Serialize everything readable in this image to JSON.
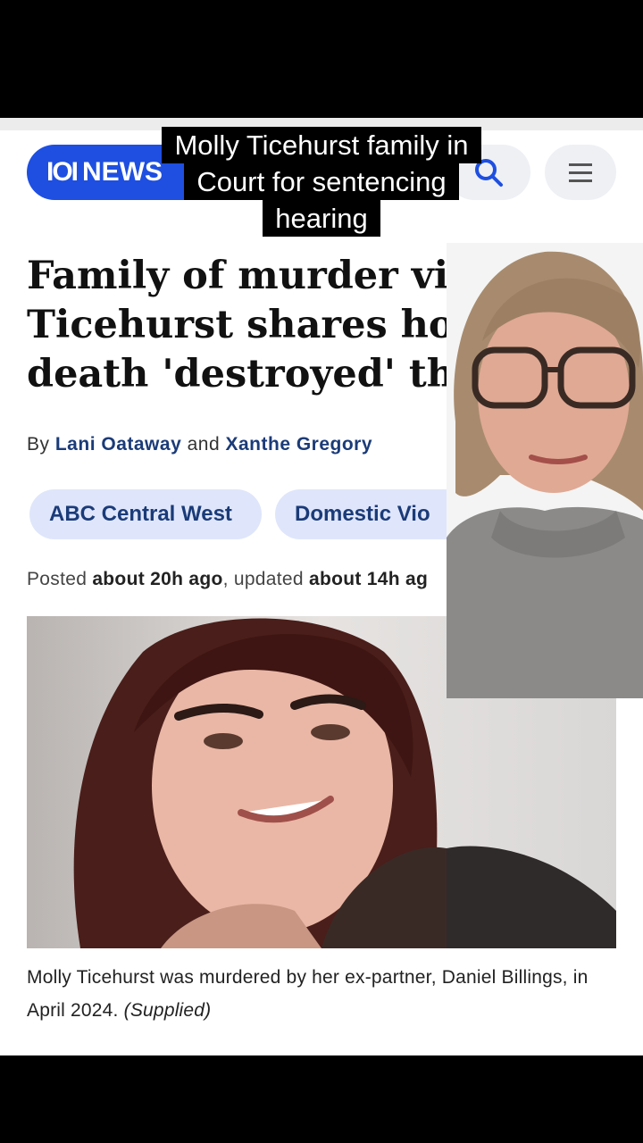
{
  "header": {
    "logo_mark": "ΙΟΙ",
    "logo_text": "NEWS",
    "search_icon": "search-icon",
    "menu_icon": "hamburger-menu-icon"
  },
  "video_caption": {
    "line1": "Molly Ticehurst family in",
    "line2": "Court for sentencing",
    "line3": "hearing"
  },
  "article": {
    "headline_line1": "Family of murder victim",
    "headline_line2": "Ticehurst shares how h",
    "headline_line3": "death 'destroyed' them",
    "byline_prefix": "By",
    "author1": "Lani Oataway",
    "byline_and": "and",
    "author2": "Xanthe Gregory",
    "tags": [
      "ABC Central West",
      "Domestic Vio"
    ],
    "posted_label": "Posted",
    "posted_value": "about 20h ago",
    "updated_label": ", updated",
    "updated_value": "about 14h ag",
    "photo_caption": "Molly Ticehurst was murdered by her ex-partner, Daniel Billings, in April 2024.",
    "photo_credit": "(Supplied)"
  },
  "colors": {
    "brand_blue": "#1e4fe0",
    "tag_bg": "#dfe6fb",
    "link_text": "#1b3b78"
  }
}
